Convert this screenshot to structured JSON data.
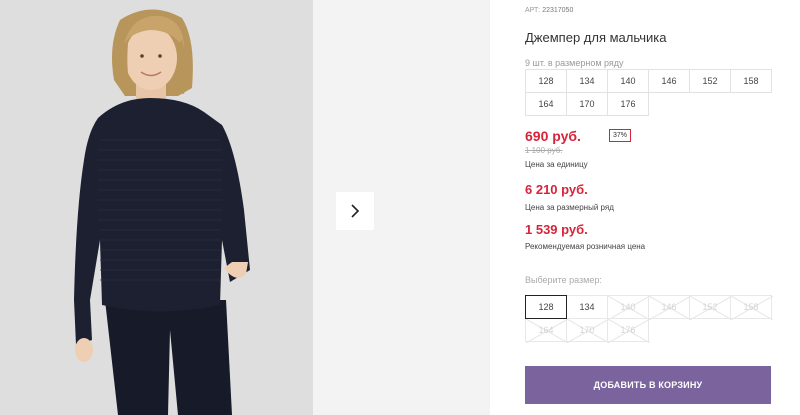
{
  "product": {
    "article_label": "АРТ:",
    "article_value": "22317050",
    "title": "Джемпер для мальчика",
    "pack_note": "9 шт. в размерном ряду",
    "size_rows": [
      [
        "128",
        "134",
        "140",
        "146",
        "152",
        "158"
      ],
      [
        "164",
        "170",
        "176"
      ]
    ]
  },
  "prices": {
    "current": "690 руб.",
    "discount": "37%",
    "old": "1 100 руб.",
    "unit_label": "Цена за единицу",
    "row_price": "6 210 руб.",
    "row_label": "Цена за размерный ряд",
    "retail_price": "1 539 руб.",
    "retail_label": "Рекомендуемая розничная цена"
  },
  "size_selector": {
    "label": "Выберите размер:",
    "rows": [
      [
        "128",
        "134",
        "140",
        "146",
        "152",
        "158"
      ],
      [
        "164",
        "170",
        "176"
      ]
    ],
    "selected": "128",
    "available": [
      "128",
      "134"
    ]
  },
  "cart": {
    "add_label": "ДОБАВИТЬ В КОРЗИНУ"
  },
  "colors": {
    "accent_red": "#d6243a",
    "button_purple": "#7b649e",
    "sweater_navy": "#1d2030"
  },
  "icons": {
    "next": "chevron-right-icon"
  }
}
